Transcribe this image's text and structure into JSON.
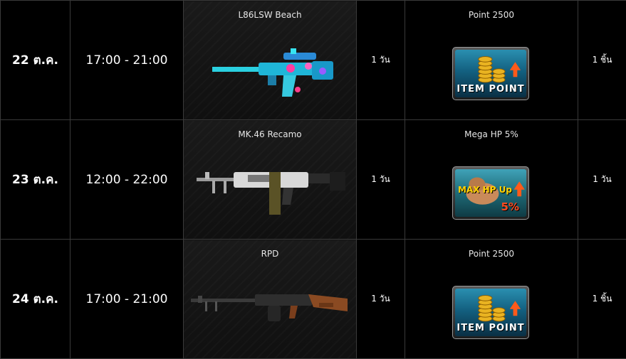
{
  "rows": [
    {
      "date": "22 ต.ค.",
      "time": "17:00 - 21:00",
      "item": "L86LSW Beach",
      "duration": "1 วัน",
      "reward": "Point 2500",
      "reward_badge": "ITEM POINT",
      "reward_icon": "item-point-coins-icon",
      "quantity": "1 ชิ้น"
    },
    {
      "date": "23 ต.ค.",
      "time": "12:00 - 22:00",
      "item": "MK.46 Recamo",
      "duration": "1 วัน",
      "reward": "Mega HP 5%",
      "reward_badge": "MAX HP Up",
      "reward_badge_pct": "5%",
      "reward_icon": "max-hp-up-icon",
      "quantity": "1 วัน"
    },
    {
      "date": "24 ต.ค.",
      "time": "17:00 - 21:00",
      "item": "RPD",
      "duration": "1 วัน",
      "reward": "Point 2500",
      "reward_badge": "ITEM POINT",
      "reward_icon": "item-point-coins-icon",
      "quantity": "1 ชิ้น"
    }
  ],
  "colors": {
    "background": "#000000",
    "border": "#3a3a3a",
    "cell_item_bg": "#141414",
    "accent_gold": "#ffd200",
    "accent_red": "#ff4b1f"
  }
}
